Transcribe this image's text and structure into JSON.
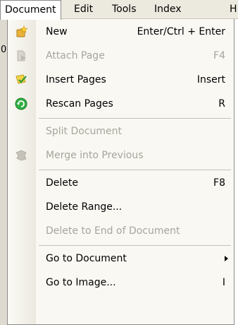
{
  "menubar": {
    "items": [
      {
        "label": "Document"
      },
      {
        "label": "Edit"
      },
      {
        "label": "Tools"
      },
      {
        "label": "Index"
      },
      {
        "label": "H"
      }
    ]
  },
  "background": {
    "left_glyph": "0"
  },
  "menu": {
    "items": [
      {
        "label": "New",
        "shortcut": "Enter/Ctrl + Enter",
        "icon": "star-new-icon",
        "enabled": true
      },
      {
        "label": "Attach Page",
        "shortcut": "F4",
        "icon": "attach-page-icon",
        "enabled": false
      },
      {
        "label": "Insert Pages",
        "shortcut": "Insert",
        "icon": "insert-pages-icon",
        "enabled": true
      },
      {
        "label": "Rescan Pages",
        "shortcut": "R",
        "icon": "rescan-icon",
        "enabled": true
      },
      {
        "label": "Split Document",
        "shortcut": "",
        "icon": "",
        "enabled": false
      },
      {
        "label": "Merge into Previous",
        "shortcut": "",
        "icon": "merge-icon",
        "enabled": false
      },
      {
        "label": "Delete",
        "shortcut": "F8",
        "icon": "",
        "enabled": true
      },
      {
        "label": "Delete Range...",
        "shortcut": "",
        "icon": "",
        "enabled": true
      },
      {
        "label": "Delete to End of Document",
        "shortcut": "",
        "icon": "",
        "enabled": false
      },
      {
        "label": "Go to Document",
        "shortcut": "",
        "icon": "submenu-arrow-icon",
        "enabled": true
      },
      {
        "label": "Go to Image...",
        "shortcut": "I",
        "icon": "",
        "enabled": true
      }
    ]
  },
  "colors": {
    "menubar_bg": "#eceadf",
    "menu_bg": "#f9f8f3",
    "disabled_text": "#a7a59b",
    "separator": "#c5c2b4"
  }
}
